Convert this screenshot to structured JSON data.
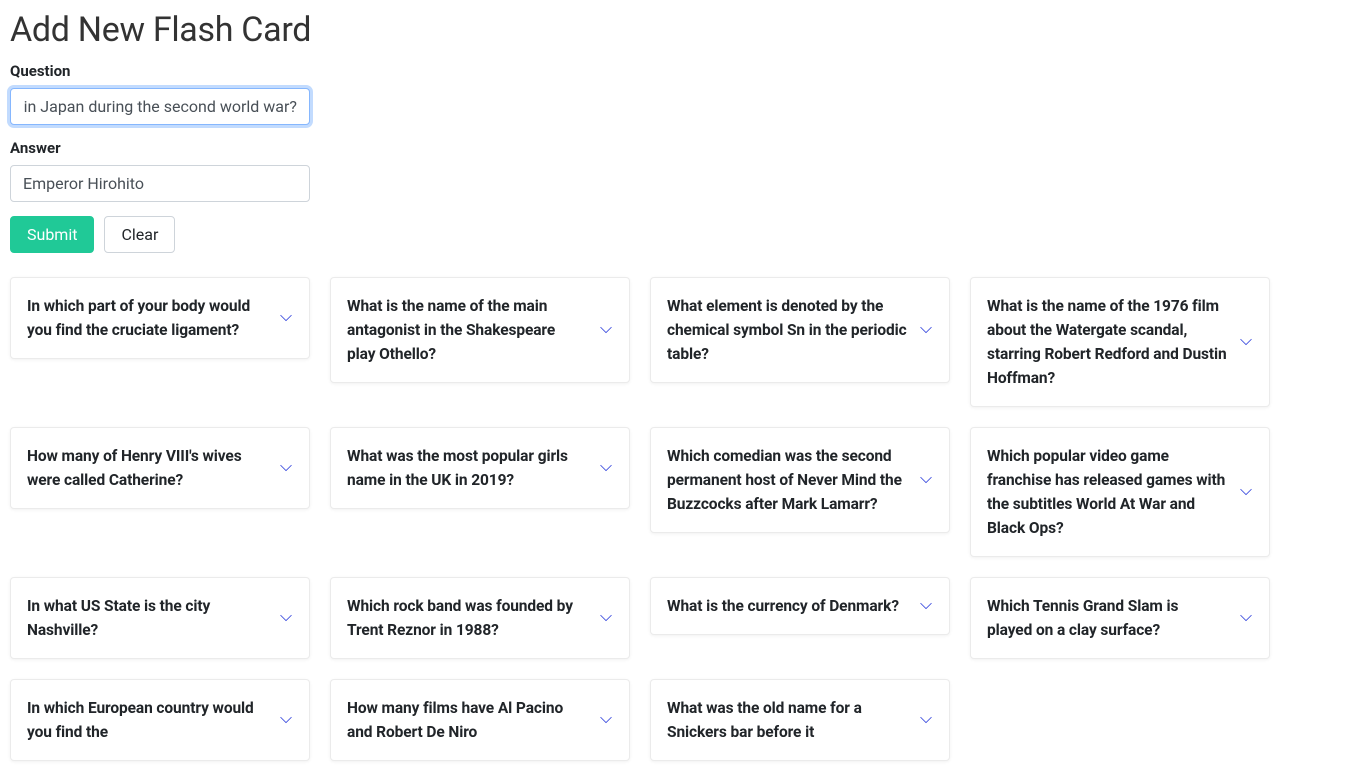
{
  "header": {
    "title": "Add New Flash Card"
  },
  "form": {
    "question_label": "Question",
    "question_value": "in Japan during the second world war?",
    "answer_label": "Answer",
    "answer_value": "Emperor Hirohito",
    "submit_label": "Submit",
    "clear_label": "Clear"
  },
  "cards": [
    {
      "q": "In which part of your body would you find the cruciate ligament?"
    },
    {
      "q": "What is the name of the main antagonist in the Shakespeare play Othello?"
    },
    {
      "q": "What element is denoted by the chemical symbol Sn in the periodic table?"
    },
    {
      "q": "What is the name of the 1976 film about the Watergate scandal, starring Robert Redford and Dustin Hoffman?"
    },
    {
      "q": "How many of Henry VIII's wives were called Catherine?"
    },
    {
      "q": "What was the most popular girls name in the UK in 2019?"
    },
    {
      "q": "Which comedian was the second permanent host of Never Mind the Buzzcocks after Mark Lamarr?"
    },
    {
      "q": "Which popular video game franchise has released games with the subtitles World At War and Black Ops?"
    },
    {
      "q": "In what US State is the city Nashville?"
    },
    {
      "q": "Which rock band was founded by Trent Reznor in 1988?"
    },
    {
      "q": "What is the currency of Denmark?"
    },
    {
      "q": "Which Tennis Grand Slam is played on a clay surface?"
    },
    {
      "q": "In which European country would you find the"
    },
    {
      "q": "How many films have Al Pacino and Robert De Niro"
    },
    {
      "q": "What was the old name for a Snickers bar before it"
    }
  ]
}
